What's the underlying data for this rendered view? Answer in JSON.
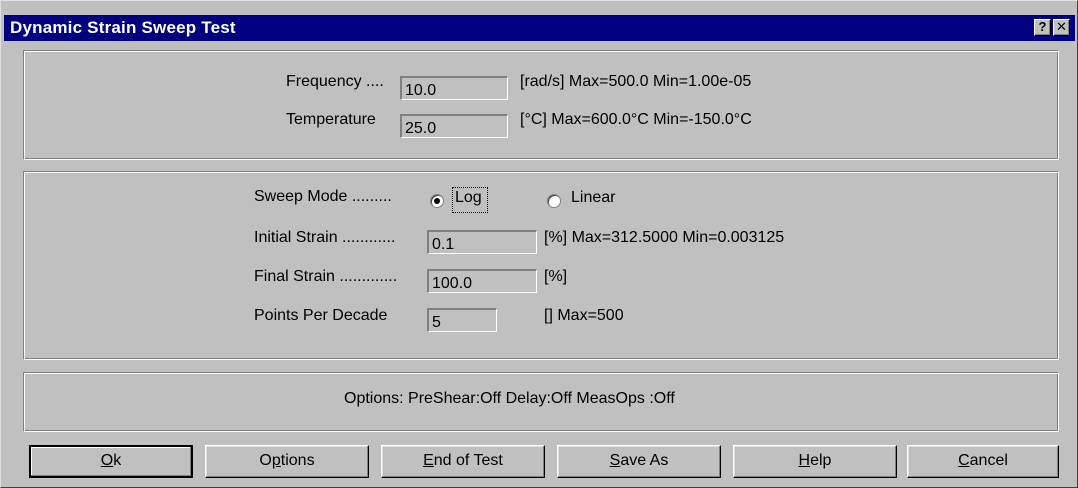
{
  "window": {
    "title": "Dynamic Strain Sweep Test",
    "help_button": "?",
    "close_button": "✕"
  },
  "conditions": {
    "frequency": {
      "label": "Frequency ....",
      "value": "10.0",
      "range": "[rad/s] Max=500.0  Min=1.00e-05"
    },
    "temperature": {
      "label": "Temperature",
      "value": "25.0",
      "range": "[°C] Max=600.0°C  Min=-150.0°C"
    }
  },
  "sweep": {
    "mode_label": "Sweep Mode .........",
    "modes": [
      {
        "label": "Log",
        "selected": true
      },
      {
        "label": "Linear",
        "selected": false
      }
    ],
    "initial_strain": {
      "label": "Initial Strain ............",
      "value": "0.1",
      "range": "[%] Max=312.5000  Min=0.003125"
    },
    "final_strain": {
      "label": "Final Strain .............",
      "value": "100.0",
      "range": "[%]"
    },
    "points_per_decade": {
      "label": "Points Per Decade",
      "value": "5",
      "range": "[] Max=500"
    }
  },
  "options_summary": "Options:  PreShear:Off  Delay:Off  MeasOps :Off",
  "buttons": {
    "ok": {
      "mnemonic": "O",
      "rest": "k"
    },
    "options": {
      "pre": "O",
      "mnemonic": "p",
      "rest": "tions"
    },
    "end_of_test": {
      "mnemonic": "E",
      "rest": "nd of Test"
    },
    "save_as": {
      "mnemonic": "S",
      "rest": "ave As"
    },
    "help": {
      "mnemonic": "H",
      "rest": "elp"
    },
    "cancel": {
      "mnemonic": "C",
      "rest": "ancel"
    }
  }
}
